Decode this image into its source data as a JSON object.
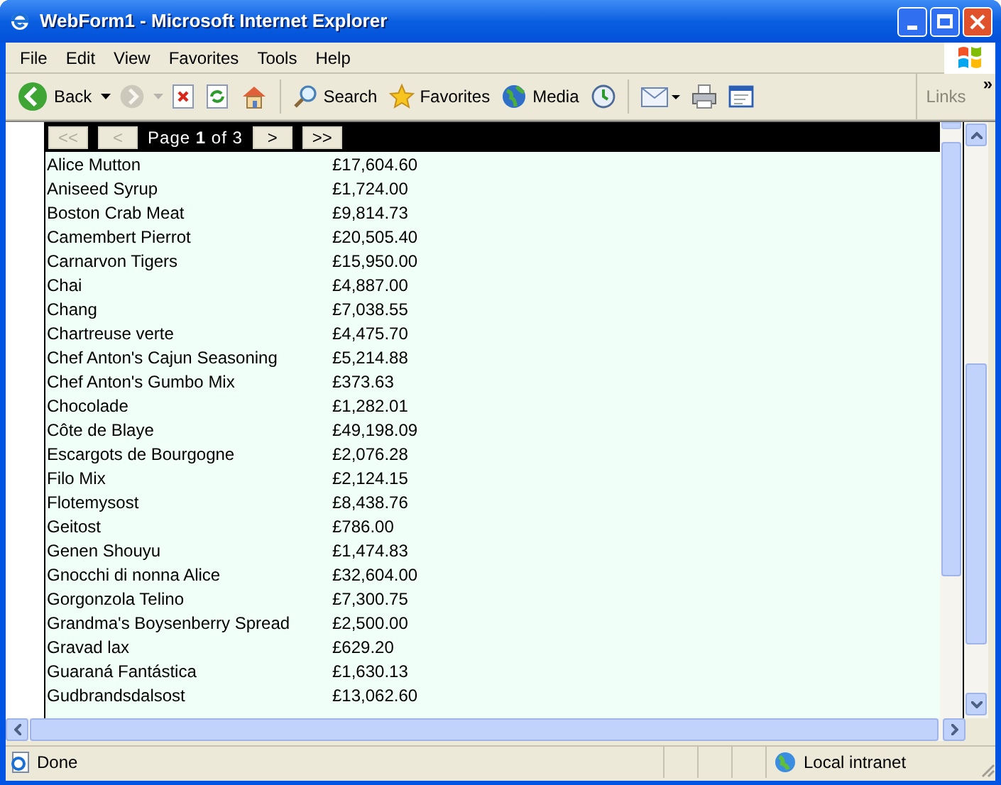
{
  "window": {
    "title": "WebForm1 - Microsoft Internet Explorer"
  },
  "menu": [
    "File",
    "Edit",
    "View",
    "Favorites",
    "Tools",
    "Help"
  ],
  "toolbar": [
    {
      "kind": "back",
      "label": "Back",
      "disabled": false
    },
    {
      "kind": "forward",
      "disabled": true
    },
    {
      "kind": "stop",
      "disabled": false
    },
    {
      "kind": "refresh",
      "disabled": false
    },
    {
      "kind": "home",
      "disabled": false
    },
    {
      "kind": "separator",
      "disabled": false
    },
    {
      "kind": "search",
      "label": "Search",
      "disabled": false
    },
    {
      "kind": "favorites",
      "label": "Favorites",
      "disabled": false
    },
    {
      "kind": "media",
      "label": "Media",
      "disabled": false
    },
    {
      "kind": "history",
      "disabled": false
    },
    {
      "kind": "separator",
      "disabled": false
    },
    {
      "kind": "mail",
      "disabled": false
    },
    {
      "kind": "print",
      "disabled": false
    },
    {
      "kind": "edit",
      "disabled": false
    }
  ],
  "links": {
    "label": "Links",
    "chevron": "»"
  },
  "pager": [
    {
      "kind": "button",
      "label": "<<",
      "disabled": true
    },
    {
      "kind": "button",
      "label": "<",
      "disabled": true
    },
    {
      "kind": "text",
      "label": "Page **1** of 3"
    },
    {
      "kind": "button",
      "label": ">",
      "disabled": false
    },
    {
      "kind": "button",
      "label": ">>",
      "disabled": false
    }
  ],
  "rows": [
    {
      "name": "Alice Mutton",
      "amount": "£17,604.60"
    },
    {
      "name": "Aniseed Syrup",
      "amount": "£1,724.00"
    },
    {
      "name": "Boston Crab Meat",
      "amount": "£9,814.73"
    },
    {
      "name": "Camembert Pierrot",
      "amount": "£20,505.40"
    },
    {
      "name": "Carnarvon Tigers",
      "amount": "£15,950.00"
    },
    {
      "name": "Chai",
      "amount": "£4,887.00"
    },
    {
      "name": "Chang",
      "amount": "£7,038.55"
    },
    {
      "name": "Chartreuse verte",
      "amount": "£4,475.70"
    },
    {
      "name": "Chef Anton's Cajun Seasoning",
      "amount": "£5,214.88"
    },
    {
      "name": "Chef Anton's Gumbo Mix",
      "amount": "£373.63"
    },
    {
      "name": "Chocolade",
      "amount": "£1,282.01"
    },
    {
      "name": "Côte de Blaye",
      "amount": "£49,198.09"
    },
    {
      "name": "Escargots de Bourgogne",
      "amount": "£2,076.28"
    },
    {
      "name": "Filo Mix",
      "amount": "£2,124.15"
    },
    {
      "name": "Flotemysost",
      "amount": "£8,438.76"
    },
    {
      "name": "Geitost",
      "amount": "£786.00"
    },
    {
      "name": "Genen Shouyu",
      "amount": "£1,474.83"
    },
    {
      "name": "Gnocchi di nonna Alice",
      "amount": "£32,604.00"
    },
    {
      "name": "Gorgonzola Telino",
      "amount": "£7,300.75"
    },
    {
      "name": "Grandma's Boysenberry Spread",
      "amount": "£2,500.00"
    },
    {
      "name": "Gravad lax",
      "amount": "£629.20"
    },
    {
      "name": "Guaraná Fantástica",
      "amount": "£1,630.13"
    },
    {
      "name": "Gudbrandsdalsost",
      "amount": "£13,062.60"
    }
  ],
  "status_bar": {
    "text": "Done",
    "zone": "Local intranet"
  }
}
